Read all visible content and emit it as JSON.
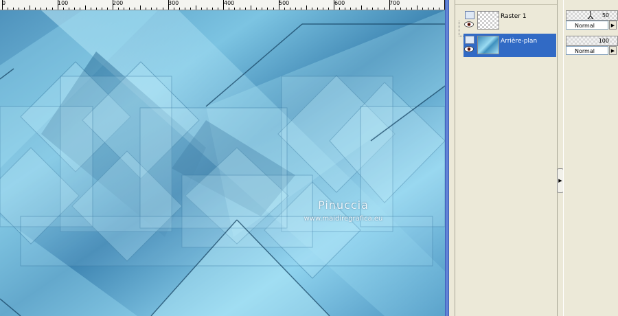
{
  "ruler": {
    "labels": [
      "0",
      "100",
      "200",
      "300",
      "400",
      "500",
      "600",
      "700"
    ]
  },
  "canvas": {
    "watermark_title": "Pinuccia",
    "watermark_url": "www.maidiregrafica.eu"
  },
  "layers": {
    "items": [
      {
        "name": "Raster 1",
        "selected": false,
        "visible": true
      },
      {
        "name": "Arrière-plan",
        "selected": true,
        "visible": true
      }
    ]
  },
  "properties": {
    "rows": [
      {
        "opacity": "50",
        "blend_mode": "Normal"
      },
      {
        "opacity": "100",
        "blend_mode": "Normal"
      }
    ]
  },
  "colors": {
    "selection": "#316ac5",
    "panel_bg": "#ece9d8",
    "canvas_base": "#5fa6cb"
  }
}
